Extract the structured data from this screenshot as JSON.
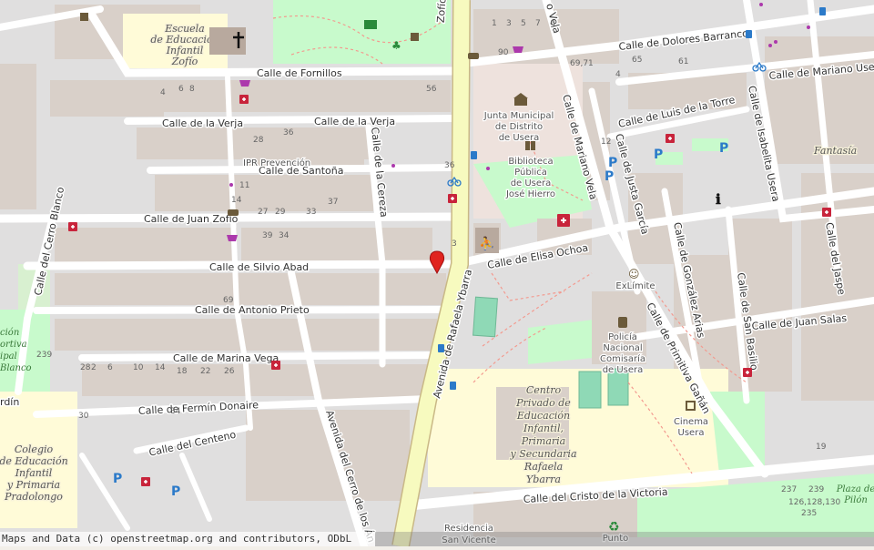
{
  "attribution": "Maps and Data (c) openstreetmap.org and contributors, ODbL",
  "colors": {
    "background": "#f2efe9",
    "building": "#d9d0c9",
    "road": "#ffffff",
    "avenue": "#f7fabf",
    "park": "#c8facc",
    "school": "#fffbd8",
    "marker": "#e0231e"
  },
  "streets": [
    "Calle de Fornillos",
    "Calle de la Verja",
    "Calle de la Verja",
    "Calle de Santoña",
    "Calle de Juan Zofío",
    "Calle de Silvio Abad",
    "Calle de Antonio Prieto",
    "Calle de Marina Vega",
    "Calle de Fermín Donaire",
    "Calle del Centeno",
    "Calle del Cerro Blanco",
    "Calle de la Cereza",
    "Avenida de Rafaela Ybarra",
    "Avenida del Cerro de los Án",
    "Calle de Elisa Ochoa",
    "Calle de Dolores Barranco",
    "Calle de Mariano Usera",
    "Calle de Luis de la Torre",
    "Calle de Mariano Vela",
    "Calle de Justa García",
    "Calle de González Arias",
    "Calle de Primitiva Gañán",
    "Calle de San Basilio",
    "Calle de Isabelita Usera",
    "Calle del Jaspe",
    "Calle de Juan Salas",
    "Calle del Cristo de la Victoria",
    "Zofío",
    "o Vela",
    "rdín"
  ],
  "pois": {
    "escuela": [
      "Escuela",
      "de Educación",
      "Infantil",
      "Zofío"
    ],
    "ipr": "IPR Prevención",
    "junta": [
      "Junta Municipal",
      "de Distrito",
      "de Usera"
    ],
    "biblioteca": [
      "Biblioteca",
      "Pública",
      "de Usera",
      "José Hierro"
    ],
    "exlimite": "ExLímite",
    "policia": [
      "Policía",
      "Nacional",
      "Comisaría",
      "de Usera"
    ],
    "cinema": [
      "Cinema",
      "Usera"
    ],
    "fantasia": "Fantasía",
    "centro": [
      "Centro",
      "Privado de",
      "Educación",
      "Infantil,",
      "Primaria",
      "y Secundaria",
      "Rafaela",
      "Ybarra"
    ],
    "colegio": [
      "Colegio",
      "de Educación",
      "Infantil",
      "y Primaria",
      "Pradolongo"
    ],
    "residencia": [
      "Residencia",
      "San Vicente"
    ],
    "punto": "Punto",
    "plaza": [
      "Plaza de",
      "Pilón"
    ],
    "park_left": [
      "ción",
      "ortiva",
      "ipal",
      "Blanco"
    ]
  },
  "house_numbers": [
    "4",
    "6",
    "8",
    "1",
    "3",
    "5",
    "7",
    "9",
    "56",
    "69,71",
    "65",
    "61",
    "90",
    "28",
    "36",
    "12",
    "14",
    "11",
    "27",
    "29",
    "33",
    "37",
    "39",
    "34",
    "36",
    "69",
    "28",
    "2",
    "6",
    "10",
    "14",
    "18",
    "22",
    "26",
    "30",
    "34",
    "19",
    "126,128,130",
    "235",
    "237",
    "239",
    "239",
    "4",
    "3",
    "5"
  ],
  "icons": [
    "marker-icon",
    "cafe-icon",
    "church-icon",
    "pharmacy-icon",
    "parking-icon",
    "bus-stop-icon",
    "bicycle-icon",
    "library-icon",
    "townhall-icon",
    "police-icon",
    "theatre-icon",
    "cinema-icon",
    "info-icon",
    "shop-icon",
    "playground-icon",
    "recycling-icon",
    "toilets-icon"
  ]
}
